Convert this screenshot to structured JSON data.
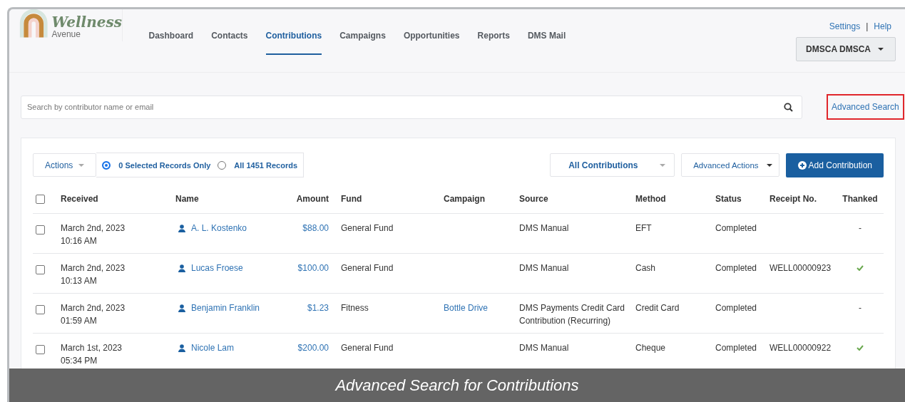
{
  "logo": {
    "title": "Wellness",
    "subtitle": "Avenue"
  },
  "nav": [
    {
      "label": "Dashboard",
      "selected": false
    },
    {
      "label": "Contacts",
      "selected": false
    },
    {
      "label": "Contributions",
      "selected": true
    },
    {
      "label": "Campaigns",
      "selected": false
    },
    {
      "label": "Opportunities",
      "selected": false
    },
    {
      "label": "Reports",
      "selected": false
    },
    {
      "label": "DMS Mail",
      "selected": false
    }
  ],
  "top_links": [
    "Settings",
    "Help"
  ],
  "separator": "|",
  "user_menu": {
    "label": "DMSCA DMSCA"
  },
  "search": {
    "placeholder": "Search by contributor name or email"
  },
  "advanced_search": {
    "label": "Advanced Search",
    "highlighted": true
  },
  "toolbar": {
    "actions": "Actions",
    "scope": [
      {
        "label": "0 Selected Records Only",
        "selected": true
      },
      {
        "label": "All 1451 Records",
        "selected": false
      }
    ],
    "filter": "All Contributions",
    "advanced_actions": "Advanced Actions",
    "add": "Add Contribution"
  },
  "table": {
    "select_all_checked": false,
    "columns": [
      "Received",
      "Name",
      "Amount",
      "Fund",
      "Campaign",
      "Source",
      "Method",
      "Status",
      "Receipt No.",
      "Thanked"
    ],
    "rows": [
      {
        "checked": false,
        "date": "March 2nd, 2023",
        "time": "10:16 AM",
        "name": "A. L. Kostenko",
        "amount": "$88.00",
        "fund": "General Fund",
        "source": "DMS Manual",
        "method": "EFT",
        "status": "Completed",
        "thanked": false,
        "thanked_text": "-"
      },
      {
        "checked": false,
        "date": "March 2nd, 2023",
        "time": "10:13 AM",
        "name": "Lucas Froese",
        "amount": "$100.00",
        "fund": "General Fund",
        "source": "DMS Manual",
        "method": "Cash",
        "status": "Completed",
        "receipt": "WELL00000923",
        "thanked": true
      },
      {
        "checked": false,
        "date": "March 2nd, 2023",
        "time": "01:59 AM",
        "name": "Benjamin Franklin",
        "amount": "$1.23",
        "fund": "Fitness",
        "campaign": "Bottle Drive",
        "source": "DMS Payments Credit Card Contribution (Recurring)",
        "method": "Credit Card",
        "status": "Completed",
        "thanked": false,
        "thanked_text": "-"
      },
      {
        "checked": false,
        "date": "March 1st, 2023",
        "time": "05:34 PM",
        "name": "Nicole Lam",
        "amount": "$200.00",
        "fund": "General Fund",
        "source": "DMS Manual",
        "method": "Cheque",
        "status": "Completed",
        "receipt": "WELL00000922",
        "thanked": true
      }
    ]
  },
  "caption": "Advanced Search for Contributions"
}
